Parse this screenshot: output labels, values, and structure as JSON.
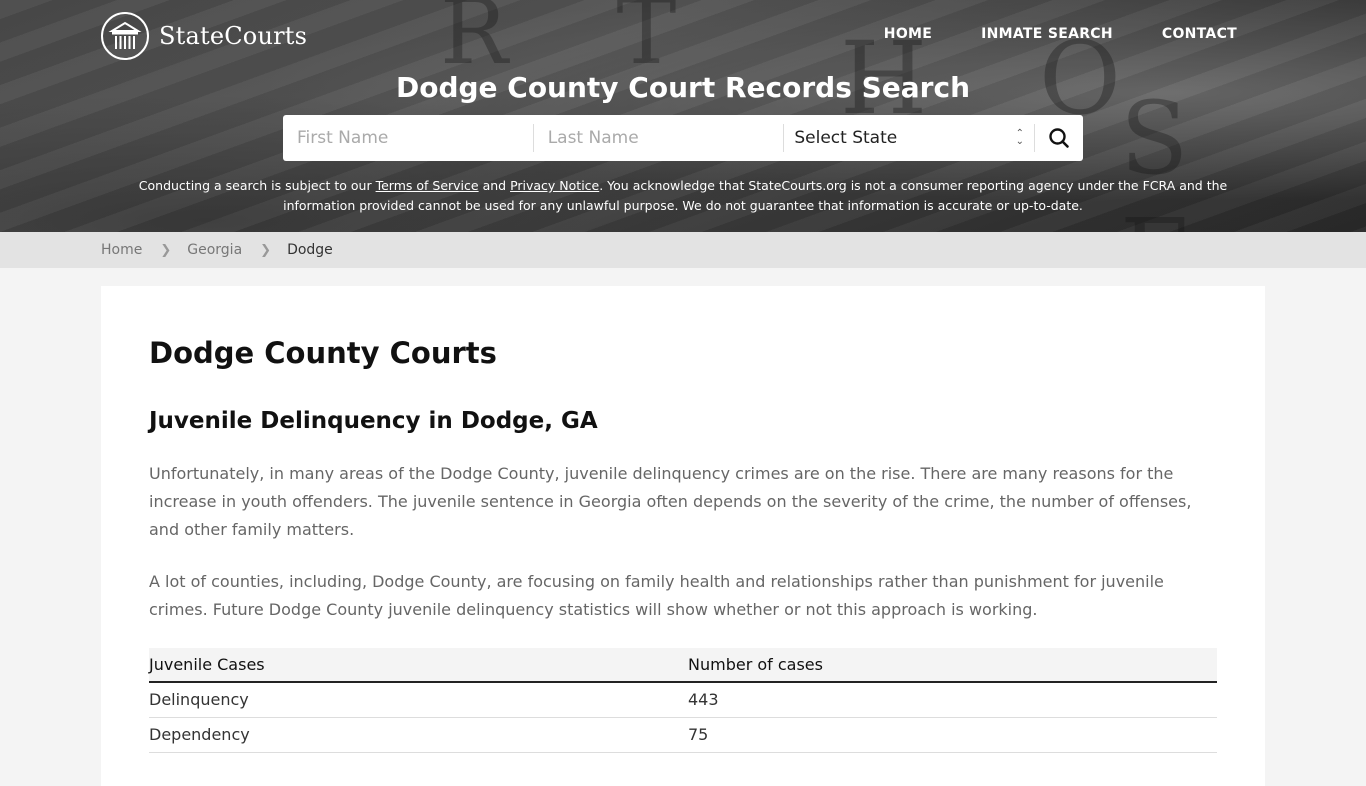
{
  "brand": {
    "name": "StateCourts",
    "logo_icon": "courthouse-pillars-icon"
  },
  "nav": [
    {
      "label": "HOME"
    },
    {
      "label": "INMATE SEARCH"
    },
    {
      "label": "CONTACT"
    }
  ],
  "hero": {
    "title": "Dodge County Court Records Search",
    "search": {
      "first_name_placeholder": "First Name",
      "last_name_placeholder": "Last Name",
      "state_select_value": "Select State",
      "search_icon": "search-icon"
    },
    "disclaimer": {
      "part1": "Conducting a search is subject to our ",
      "terms_link": "Terms of Service",
      "part2": " and ",
      "privacy_link": "Privacy Notice",
      "part3": ". You acknowledge that StateCourts.org is not a consumer reporting agency under the FCRA and the information provided cannot be used for any unlawful purpose. We do not guarantee that information is accurate or up-to-date."
    }
  },
  "breadcrumb": [
    {
      "label": "Home"
    },
    {
      "label": "Georgia"
    },
    {
      "label": "Dodge"
    }
  ],
  "main": {
    "title": "Dodge County Courts",
    "section_title": "Juvenile Delinquency in Dodge, GA",
    "paragraphs": [
      "Unfortunately, in many areas of the Dodge County, juvenile delinquency crimes are on the rise. There are many reasons for the increase in youth offenders. The juvenile sentence in Georgia often depends on the severity of the crime, the number of offenses, and other family matters.",
      "A lot of counties, including, Dodge County, are focusing on family health and relationships rather than punishment for juvenile crimes. Future Dodge County juvenile delinquency statistics will show whether or not this approach is working."
    ],
    "table": {
      "headers": [
        "Juvenile Cases",
        "Number of cases"
      ],
      "rows": [
        [
          "Delinquency",
          "443"
        ],
        [
          "Dependency",
          "75"
        ]
      ]
    }
  }
}
